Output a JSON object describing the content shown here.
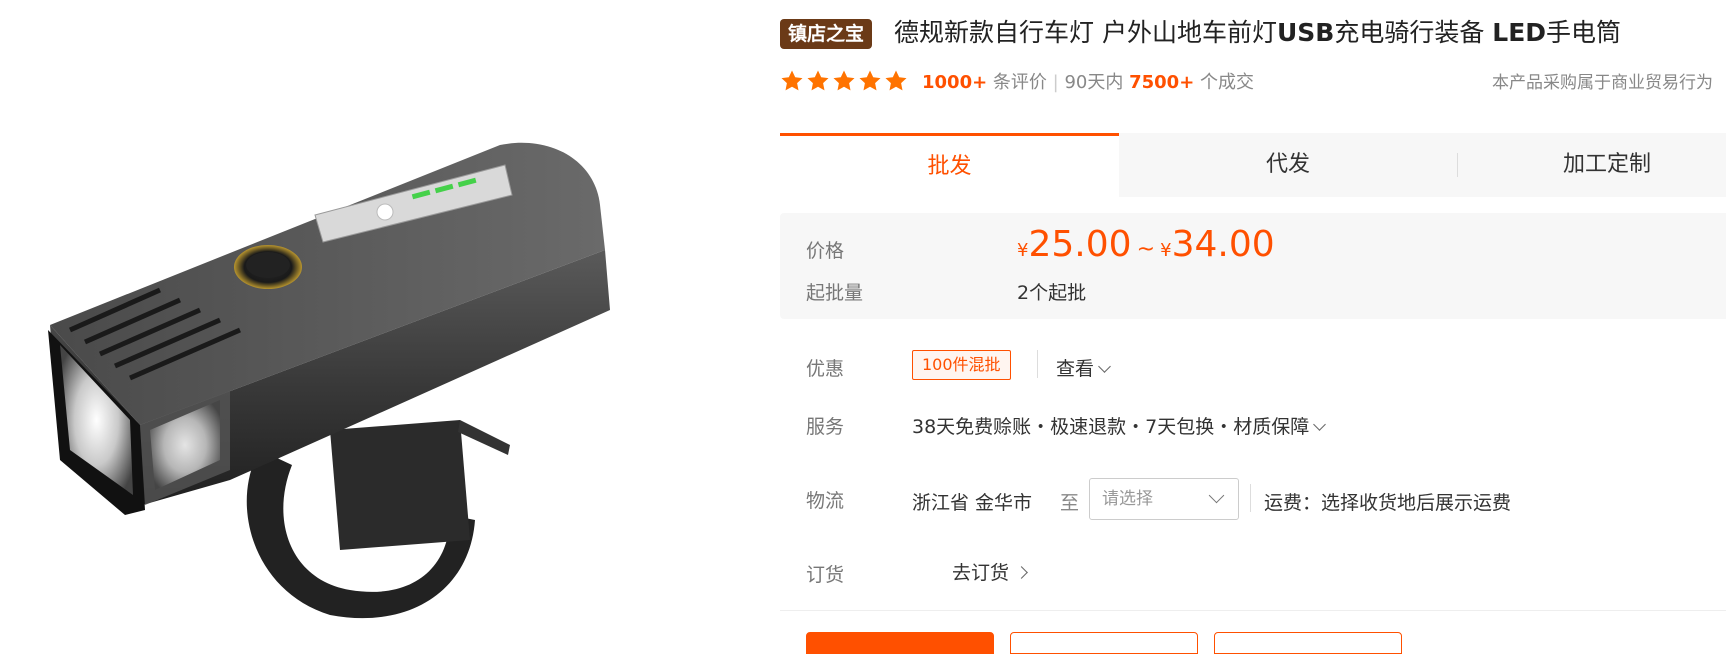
{
  "product": {
    "badge": "镇店之宝",
    "title_parts": [
      "德规新款自行车灯 户外山地车前灯",
      "USB",
      "充电骑行装备 ",
      "LED",
      "手电筒"
    ],
    "image_alt": "bicycle front light"
  },
  "rating": {
    "stars": 5,
    "reviews_count": "1000+",
    "reviews_label": "条评价",
    "sep": "|",
    "period": "90天内",
    "deals_count": "7500+",
    "deals_label": "个成交",
    "notice": "本产品采购属于商业贸易行为"
  },
  "tabs": [
    {
      "label": "批发",
      "active": true
    },
    {
      "label": "代发",
      "active": false
    },
    {
      "label": "加工定制",
      "active": false
    }
  ],
  "price": {
    "label": "价格",
    "currency": "¥",
    "min": "25.00",
    "tilde": "~",
    "max": "34.00",
    "moq_label": "起批量",
    "moq_value": "2个起批"
  },
  "promo": {
    "label": "优惠",
    "tag": "100件混批",
    "view": "查看"
  },
  "service": {
    "label": "服务",
    "text": "38天免费赊账・极速退款・7天包换・材质保障"
  },
  "logistics": {
    "label": "物流",
    "origin": "浙江省 金华市",
    "to": "至",
    "select_placeholder": "请选择",
    "fee_text": "运费：选择收货地后展示运费"
  },
  "order": {
    "label": "订货",
    "link": "去订货"
  },
  "colors": {
    "accent": "#ff5000",
    "badge_bg": "#6b3a17",
    "star": "#ff7300"
  }
}
